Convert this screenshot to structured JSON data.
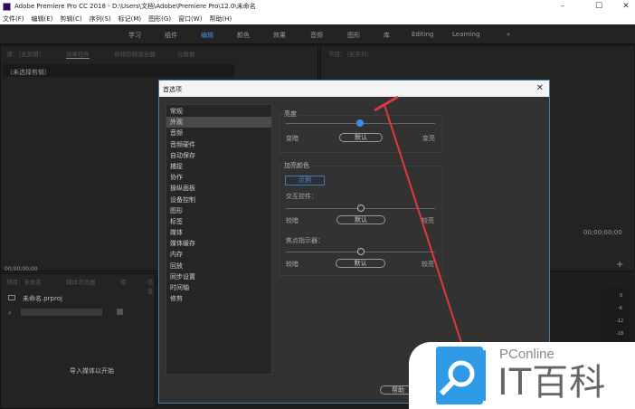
{
  "window": {
    "title": "Adobe Premiere Pro CC 2018 - D:\\Users\\文档\\Adobe\\Premiere Pro\\12.0\\未命名",
    "minimize": "–",
    "maximize": "☐",
    "close": "✕"
  },
  "menu": [
    "文件(F)",
    "编辑(E)",
    "剪辑(C)",
    "序列(S)",
    "标记(M)",
    "图形(G)",
    "窗口(W)",
    "帮助(H)"
  ],
  "workspaces": [
    "学习",
    "组件",
    "编辑",
    "颜色",
    "效果",
    "音频",
    "图形",
    "库",
    "Editing",
    "Learning"
  ],
  "workspaces_more": "»",
  "source_panel": {
    "tabs": [
      "源：（无剪辑）",
      "效果控件",
      "音频剪辑混合器",
      "元数据"
    ],
    "no_clip": "（未选择剪辑）",
    "timecode": "00;00;00;00"
  },
  "program_panel": {
    "tab": "节目：（无序列）",
    "timecode": "00;00;00;00"
  },
  "project_panel": {
    "tabs": [
      "项目：未命名",
      "媒体浏览器",
      "库",
      "信息"
    ],
    "file": "未命名.prproj",
    "empty_hint": "导入媒体以开始"
  },
  "meter_ticks": [
    "0",
    "-6",
    "-12",
    "-18"
  ],
  "dialog": {
    "title": "首选项",
    "close": "✕",
    "categories": [
      "常规",
      "外观",
      "音频",
      "音频硬件",
      "自动保存",
      "捕捉",
      "协作",
      "操纵面板",
      "设备控制",
      "图形",
      "标签",
      "媒体",
      "媒体缓存",
      "内存",
      "回放",
      "同步设置",
      "时间轴",
      "修剪"
    ],
    "selected_category": "外观",
    "brightness": {
      "label": "亮度",
      "left": "变暗",
      "right": "变亮",
      "default": "默认",
      "value": 0.5
    },
    "highlight": {
      "label": "加亮颜色",
      "sample": "示例",
      "interactive": {
        "label": "交互控件：",
        "left": "较暗",
        "right": "较亮",
        "default": "默认",
        "value": 0.5
      },
      "focus": {
        "label": "焦点指示器：",
        "left": "较暗",
        "right": "较亮",
        "default": "默认",
        "value": 0.5
      }
    },
    "help": "帮助"
  },
  "watermark": {
    "brand": "PConline",
    "name": "IT百科"
  },
  "colors": {
    "accent": "#3b8fe8",
    "arrow": "#e03a3a",
    "watermark_blue": "#2f9be6"
  }
}
